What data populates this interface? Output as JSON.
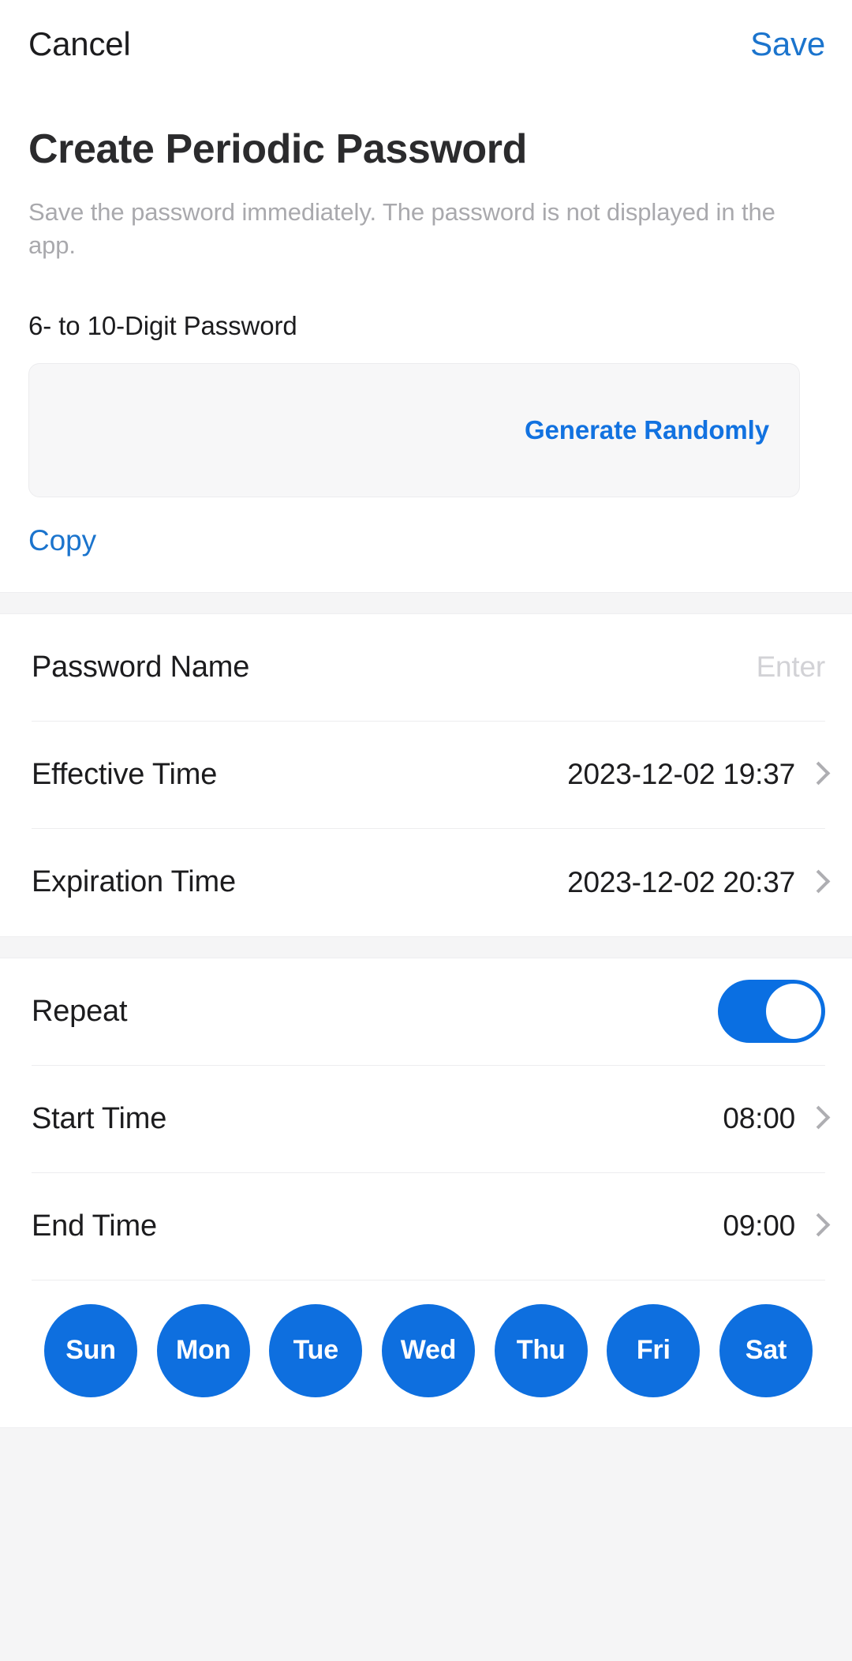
{
  "navbar": {
    "cancel_label": "Cancel",
    "save_label": "Save"
  },
  "header": {
    "title": "Create Periodic Password",
    "subtitle": "Save the password immediately. The password is not displayed in the app."
  },
  "password_field": {
    "label": "6- to 10-Digit Password",
    "value": "",
    "generate_label": "Generate Randomly",
    "copy_label": "Copy"
  },
  "details_section": {
    "rows": [
      {
        "label": "Password Name",
        "value": "Enter",
        "is_placeholder": true
      },
      {
        "label": "Effective Time",
        "value": "2023-12-02 19:37",
        "is_placeholder": false
      },
      {
        "label": "Expiration Time",
        "value": "2023-12-02 20:37",
        "is_placeholder": false
      }
    ]
  },
  "repeat_section": {
    "repeat_label": "Repeat",
    "repeat_on": true,
    "start_time_label": "Start Time",
    "start_time_value": "08:00",
    "end_time_label": "End Time",
    "end_time_value": "09:00",
    "days": [
      {
        "label": "Sun",
        "selected": true
      },
      {
        "label": "Mon",
        "selected": true
      },
      {
        "label": "Tue",
        "selected": true
      },
      {
        "label": "Wed",
        "selected": true
      },
      {
        "label": "Thu",
        "selected": true
      },
      {
        "label": "Fri",
        "selected": true
      },
      {
        "label": "Sat",
        "selected": true
      }
    ]
  },
  "colors": {
    "accent_blue": "#1b74cd",
    "toggle_on": "#0a6fe2",
    "day_selected": "#0e6fdf",
    "generate_blue": "#1272e0"
  }
}
